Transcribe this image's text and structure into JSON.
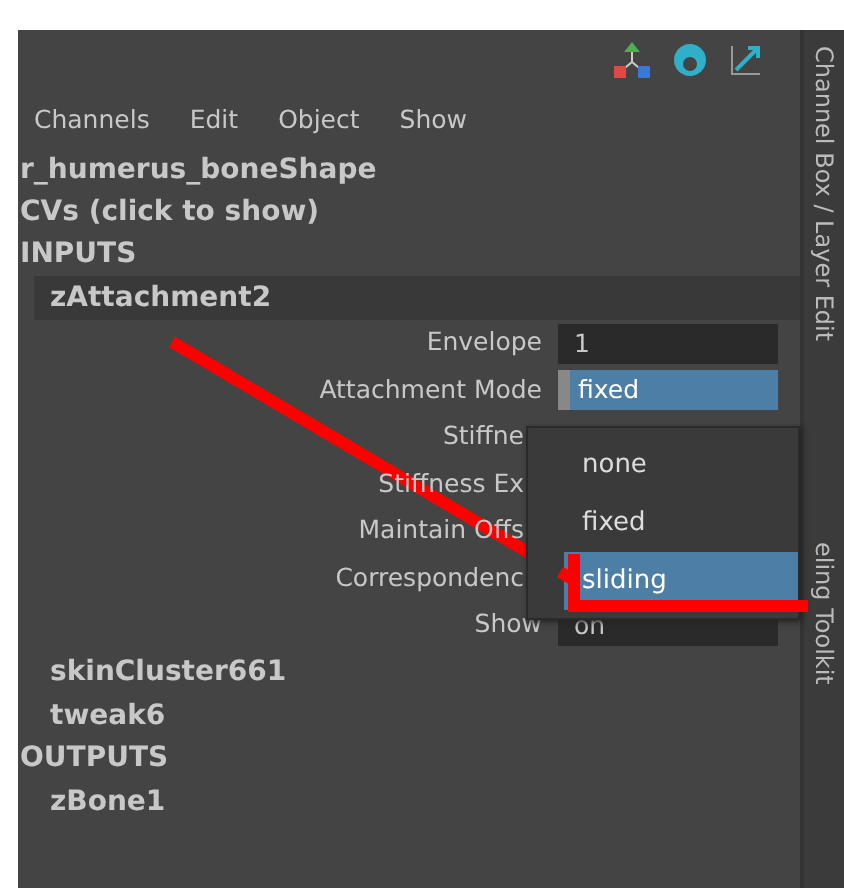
{
  "menu": [
    "Channels",
    "Edit",
    "Object",
    "Show"
  ],
  "node_name": "r_humerus_boneShape",
  "cvs": "CVs (click to show)",
  "inputs_header": "INPUTS",
  "inputs": [
    {
      "name": "zAttachment2",
      "selected": true,
      "attributes": [
        {
          "label": "Envelope",
          "value": "1",
          "highlighted": false
        },
        {
          "label": "Attachment Mode",
          "value": "fixed",
          "highlighted": true
        },
        {
          "label": "Stiffne"
        },
        {
          "label": "Stiffness Ex"
        },
        {
          "label": "Maintain Offs"
        },
        {
          "label": "Correspondenc"
        },
        {
          "label": "Show",
          "value": "on",
          "highlighted": false
        }
      ]
    },
    {
      "name": "skinCluster661",
      "selected": false
    },
    {
      "name": "tweak6",
      "selected": false
    }
  ],
  "outputs_header": "OUTPUTS",
  "outputs": [
    {
      "name": "zBone1"
    }
  ],
  "dropdown": [
    {
      "label": "none",
      "selected": false
    },
    {
      "label": "fixed",
      "selected": false
    },
    {
      "label": "sliding",
      "selected": true
    }
  ],
  "side_tabs": [
    "Channel Box / Layer Edit",
    "eling Toolkit"
  ]
}
